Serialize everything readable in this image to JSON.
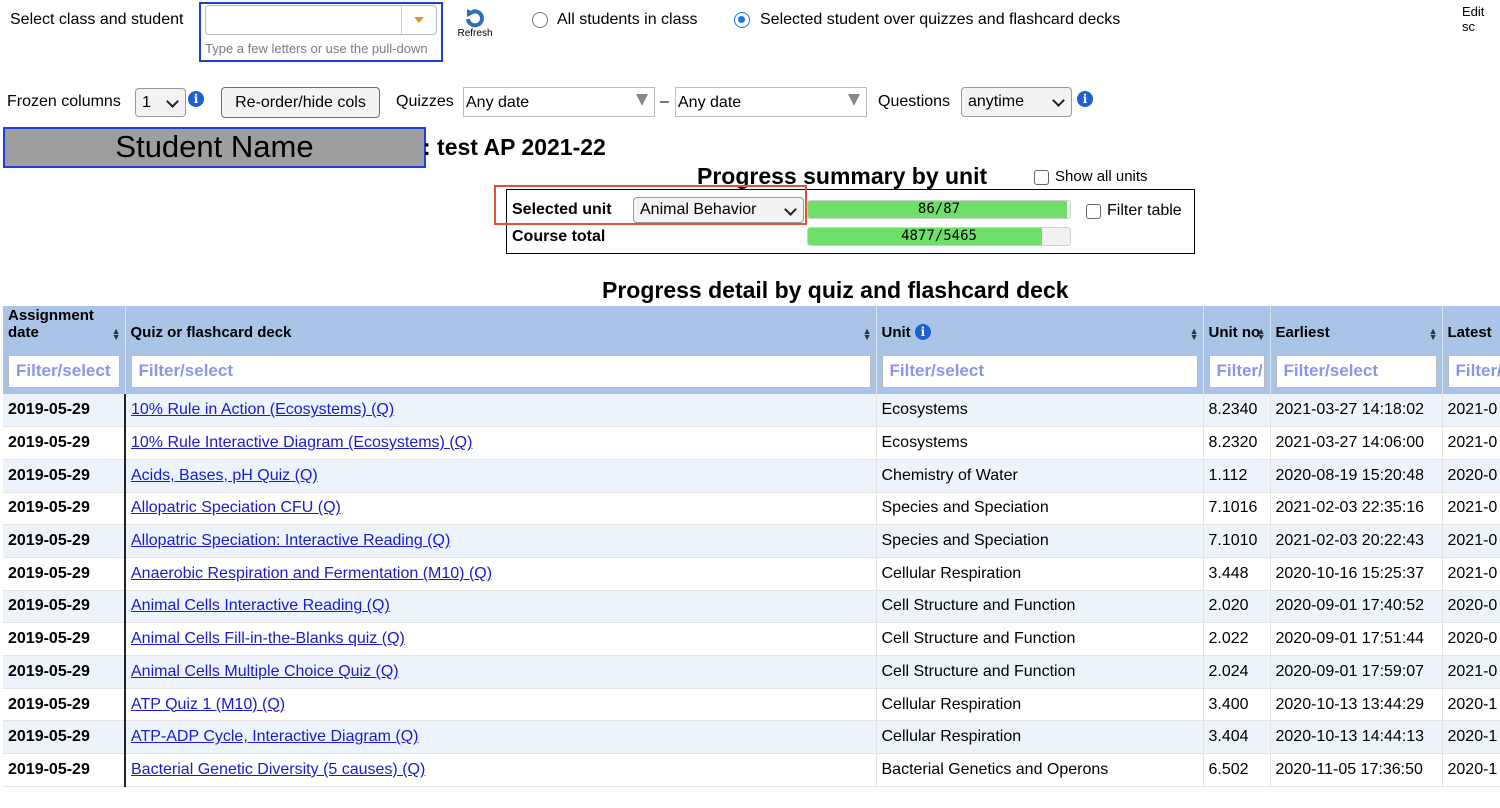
{
  "top": {
    "select_label": "Select class and student",
    "class_input_value": "",
    "class_input_hint": "Type a few letters or use the pull-down",
    "refresh_label": "Refresh",
    "radio_all": "All students in class",
    "radio_selected": "Selected student over quizzes and flashcard decks",
    "edit_label": "Edit sc"
  },
  "toolbar": {
    "frozen_label": "Frozen columns",
    "frozen_value": "1",
    "reorder_label": "Re-order/hide cols",
    "quizzes_label": "Quizzes",
    "date_from": "Any date",
    "dash": "–",
    "date_to": "Any date",
    "questions_label": "Questions",
    "questions_value": "anytime"
  },
  "student": {
    "name": "Student Name",
    "class_title": ": test AP 2021-22"
  },
  "summary": {
    "title": "Progress summary by unit",
    "show_all_label": "Show all units",
    "selected_unit_label": "Selected unit",
    "selected_unit_value": "Animal Behavior",
    "unit_progress_text": "86/87",
    "unit_progress_fraction": 0.988,
    "filter_table_label": "Filter table",
    "course_total_label": "Course total",
    "course_progress_text": "4877/5465",
    "course_progress_fraction": 0.892
  },
  "detail": {
    "title": "Progress detail by quiz and flashcard deck",
    "columns": [
      "Assignment date",
      "Quiz or flashcard deck",
      "Unit",
      "Unit no",
      "Earliest",
      "Latest"
    ],
    "filter_placeholder": "Filter/select",
    "rows": [
      {
        "date": "2019-05-29",
        "quiz": "10% Rule in Action (Ecosystems) (Q)",
        "unit": "Ecosystems",
        "unit_no": "8.2340",
        "earliest": "2021-03-27 14:18:02",
        "latest": "2021-0"
      },
      {
        "date": "2019-05-29",
        "quiz": "10% Rule Interactive Diagram (Ecosystems) (Q)",
        "unit": "Ecosystems",
        "unit_no": "8.2320",
        "earliest": "2021-03-27 14:06:00",
        "latest": "2021-0"
      },
      {
        "date": "2019-05-29",
        "quiz": "Acids, Bases, pH Quiz (Q)",
        "unit": "Chemistry of Water",
        "unit_no": "1.112",
        "earliest": "2020-08-19 15:20:48",
        "latest": "2020-0"
      },
      {
        "date": "2019-05-29",
        "quiz": "Allopatric Speciation CFU (Q)",
        "unit": "Species and Speciation",
        "unit_no": "7.1016",
        "earliest": "2021-02-03 22:35:16",
        "latest": "2021-0"
      },
      {
        "date": "2019-05-29",
        "quiz": "Allopatric Speciation: Interactive Reading (Q)",
        "unit": "Species and Speciation",
        "unit_no": "7.1010",
        "earliest": "2021-02-03 20:22:43",
        "latest": "2021-0"
      },
      {
        "date": "2019-05-29",
        "quiz": "Anaerobic Respiration and Fermentation (M10) (Q)",
        "unit": "Cellular Respiration",
        "unit_no": "3.448",
        "earliest": "2020-10-16 15:25:37",
        "latest": "2021-0"
      },
      {
        "date": "2019-05-29",
        "quiz": "Animal Cells Interactive Reading (Q)",
        "unit": "Cell Structure and Function",
        "unit_no": "2.020",
        "earliest": "2020-09-01 17:40:52",
        "latest": "2020-0"
      },
      {
        "date": "2019-05-29",
        "quiz": "Animal Cells Fill-in-the-Blanks quiz (Q)",
        "unit": "Cell Structure and Function",
        "unit_no": "2.022",
        "earliest": "2020-09-01 17:51:44",
        "latest": "2020-0"
      },
      {
        "date": "2019-05-29",
        "quiz": "Animal Cells Multiple Choice Quiz (Q)",
        "unit": "Cell Structure and Function",
        "unit_no": "2.024",
        "earliest": "2020-09-01 17:59:07",
        "latest": "2021-0"
      },
      {
        "date": "2019-05-29",
        "quiz": "ATP Quiz 1 (M10) (Q)",
        "unit": "Cellular Respiration",
        "unit_no": "3.400",
        "earliest": "2020-10-13 13:44:29",
        "latest": "2020-1"
      },
      {
        "date": "2019-05-29",
        "quiz": "ATP-ADP Cycle, Interactive Diagram (Q)",
        "unit": "Cellular Respiration",
        "unit_no": "3.404",
        "earliest": "2020-10-13 14:44:13",
        "latest": "2020-1"
      },
      {
        "date": "2019-05-29",
        "quiz": "Bacterial Genetic Diversity (5 causes) (Q)",
        "unit": "Bacterial Genetics and Operons",
        "unit_no": "6.502",
        "earliest": "2020-11-05 17:36:50",
        "latest": "2020-1"
      }
    ]
  },
  "colors": {
    "header_bg": "#a9c4e7",
    "highlight_blue": "#1f3fd8",
    "highlight_red": "#e0523a",
    "progress_green": "#6ee06a",
    "link": "#1a1ad0"
  }
}
